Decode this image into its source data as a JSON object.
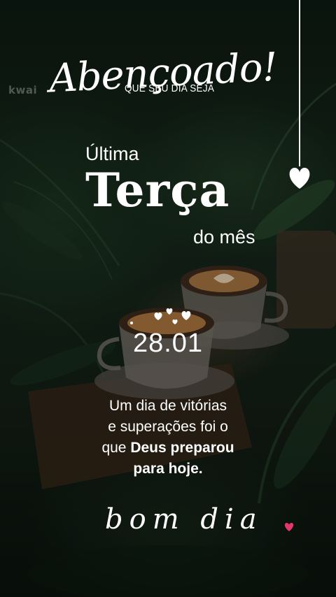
{
  "watermark": "kwai",
  "header": {
    "script_word": "Abençoado!",
    "pre_text": "QUE SEU DIA SEJA"
  },
  "title": {
    "line1": "Última",
    "line2": "Terça",
    "line3": "do mês"
  },
  "date": "28.01",
  "message": {
    "line1": "Um dia de vitórias",
    "line2": "e superações foi o",
    "line3_plain": "que ",
    "line3_bold": "Deus preparou",
    "line4_bold": "para hoje."
  },
  "footer": {
    "greeting": "bom dia"
  },
  "colors": {
    "text": "#ffffff",
    "accent_heart": "#e3356e",
    "background": "#12201a"
  },
  "icons": [
    "hanging-heart-icon",
    "mini-hearts-icon",
    "pink-heart-icon"
  ]
}
